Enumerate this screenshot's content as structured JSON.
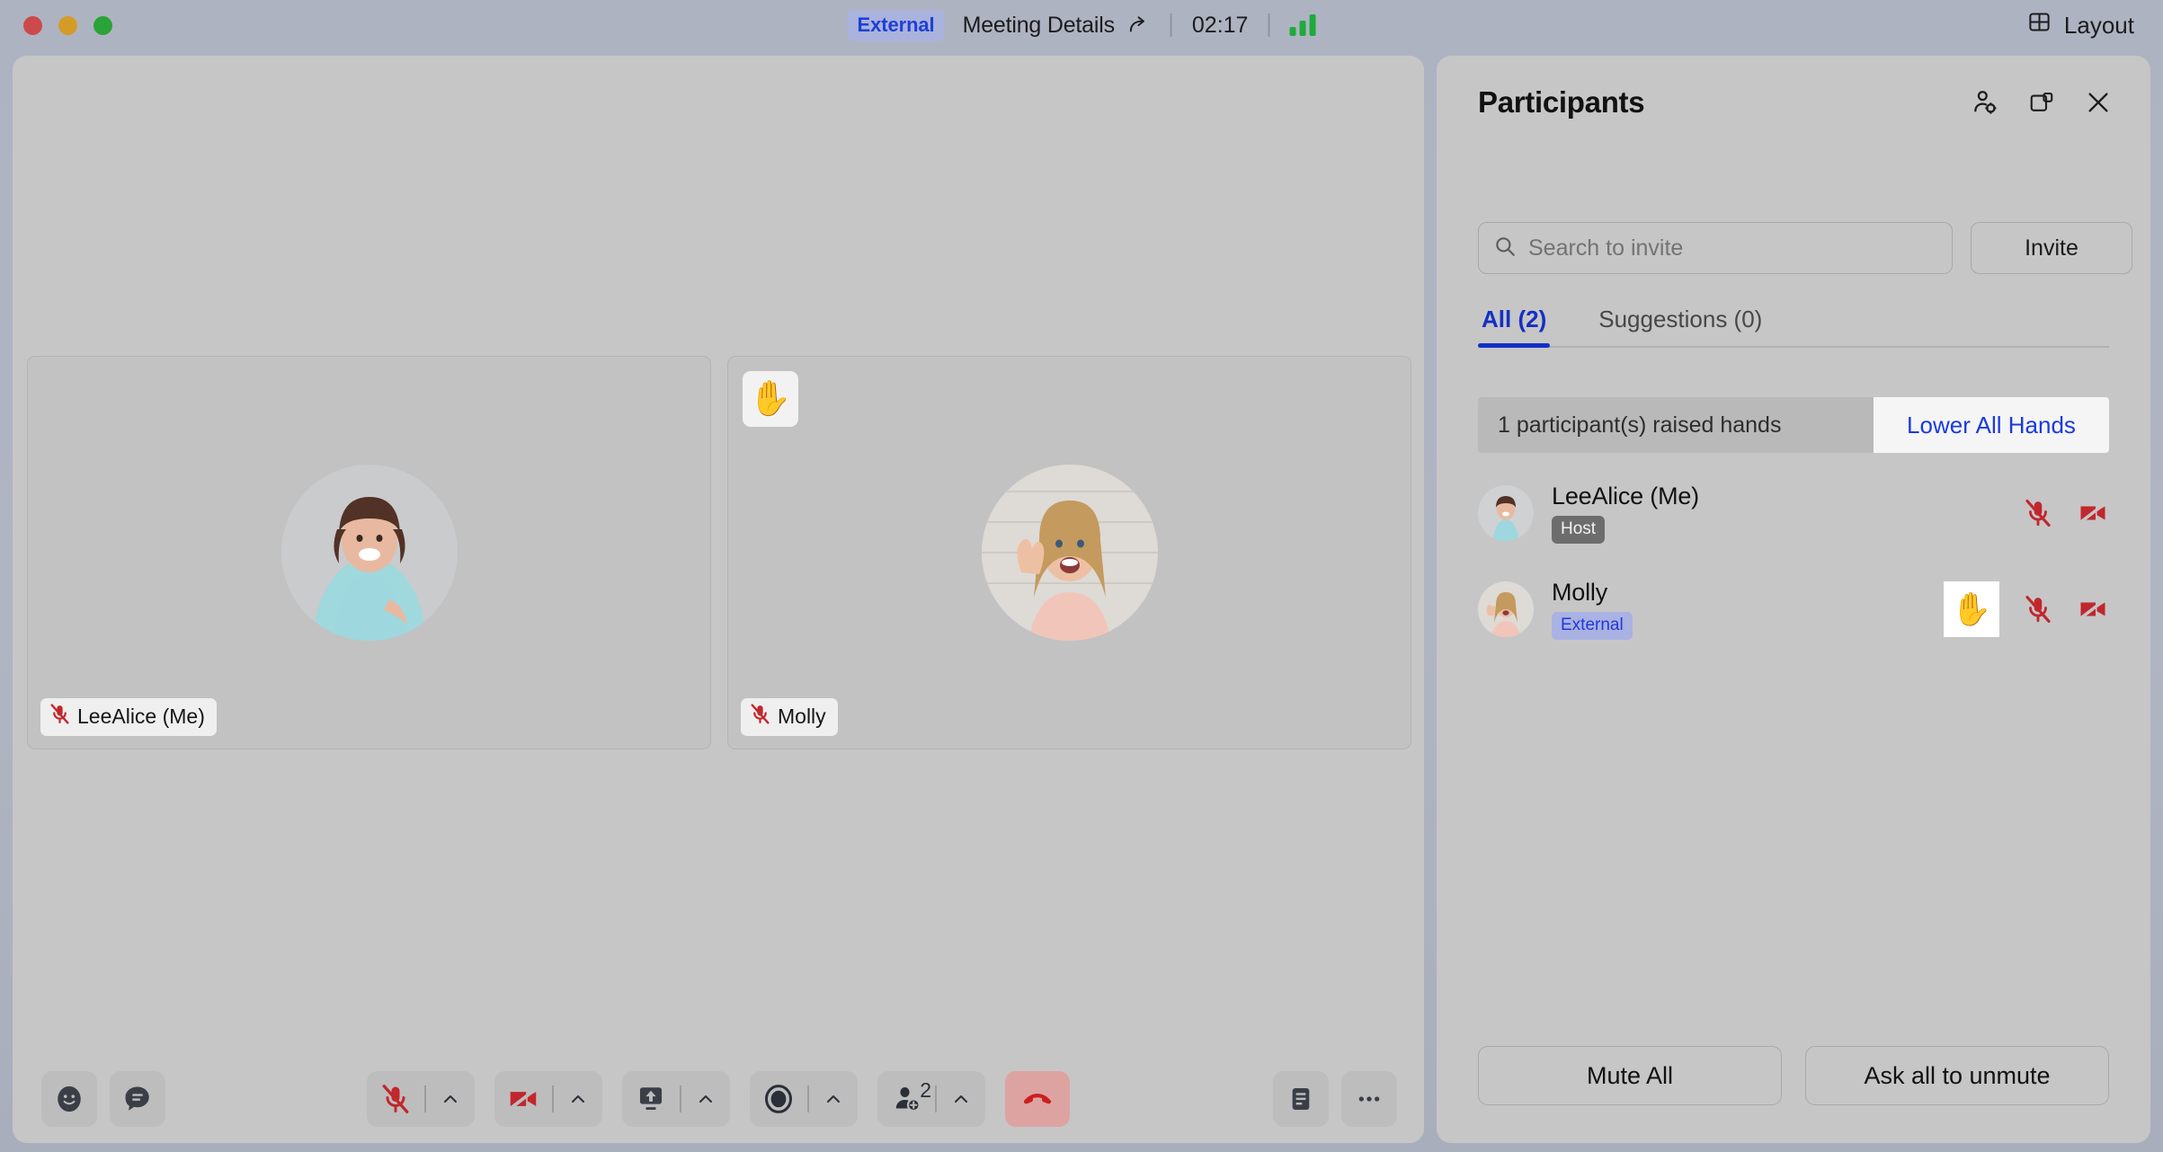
{
  "titlebar": {
    "external_badge": "External",
    "meeting_details": "Meeting Details",
    "share_icon": "share-icon",
    "timer": "02:17",
    "signal_icon": "signal-strength-icon",
    "layout_label": "Layout",
    "layout_icon": "grid-layout-icon",
    "traffic_lights": [
      "close-red",
      "minimize-amber",
      "zoom-green"
    ]
  },
  "stage": {
    "tiles": [
      {
        "name": "LeeAlice (Me)",
        "muted": true,
        "mic_icon": "mic-muted-icon",
        "hand_raised": false,
        "hand_icon": ""
      },
      {
        "name": "Molly",
        "muted": true,
        "mic_icon": "mic-muted-icon",
        "hand_raised": true,
        "hand_icon": "✋"
      }
    ]
  },
  "toolbar": {
    "left": [
      {
        "name": "reactions-button",
        "icon": "smiley-face-icon"
      },
      {
        "name": "chat-button",
        "icon": "chat-bubble-icon"
      }
    ],
    "center": [
      {
        "name": "mic-button",
        "icon": "mic-muted-icon",
        "state": "muted",
        "has_caret": true,
        "caret": "chevron-up-icon"
      },
      {
        "name": "camera-button",
        "icon": "camera-muted-icon",
        "state": "muted",
        "has_caret": true,
        "caret": "chevron-up-icon"
      },
      {
        "name": "share-screen-button",
        "icon": "share-screen-icon",
        "state": "off",
        "has_caret": true,
        "caret": "chevron-up-icon"
      },
      {
        "name": "record-button",
        "icon": "record-circle-icon",
        "state": "off",
        "has_caret": true,
        "caret": "chevron-up-icon"
      },
      {
        "name": "participants-button",
        "icon": "add-person-icon",
        "count": "2",
        "has_caret": true,
        "caret": "chevron-up-icon"
      },
      {
        "name": "hangup-button",
        "icon": "end-call-icon",
        "state": "danger",
        "has_caret": false,
        "caret": ""
      }
    ],
    "right": [
      {
        "name": "notes-button",
        "icon": "notes-icon"
      },
      {
        "name": "more-options-button",
        "icon": "ellipsis-icon"
      }
    ]
  },
  "panel": {
    "title": "Participants",
    "header_icons": [
      {
        "name": "manage-participants-icon",
        "label": "manage-participants"
      },
      {
        "name": "popout-panel-icon",
        "label": "pop-out"
      },
      {
        "name": "close-icon",
        "label": "close"
      }
    ],
    "search": {
      "placeholder": "Search to invite",
      "value": "",
      "icon": "search-icon"
    },
    "invite_label": "Invite",
    "tabs": [
      {
        "label": "All (2)",
        "active": true
      },
      {
        "label": "Suggestions (0)",
        "active": false
      }
    ],
    "hands_banner": {
      "text": "1 participant(s) raised hands",
      "action": "Lower All Hands"
    },
    "participants": [
      {
        "name": "LeeAlice (Me)",
        "tag": "Host",
        "tag_type": "host",
        "hand_raised": false,
        "hand_icon": "",
        "mic_icon": "mic-muted-icon",
        "camera_icon": "camera-muted-icon"
      },
      {
        "name": "Molly",
        "tag": "External",
        "tag_type": "external",
        "hand_raised": true,
        "hand_icon": "✋",
        "mic_icon": "mic-muted-icon",
        "camera_icon": "camera-muted-icon"
      }
    ],
    "footer": {
      "mute_all": "Mute All",
      "ask_unmute": "Ask all to unmute"
    }
  },
  "colors": {
    "accent_blue": "#1430c4",
    "link_blue": "#1a3ae0",
    "danger_red": "#c1272d",
    "panel_bg": "#c6c6c6",
    "window_bg": "#aeb3c1",
    "host_tag_bg": "#6d6d6d",
    "external_tag_bg": "#a9b2e3"
  }
}
